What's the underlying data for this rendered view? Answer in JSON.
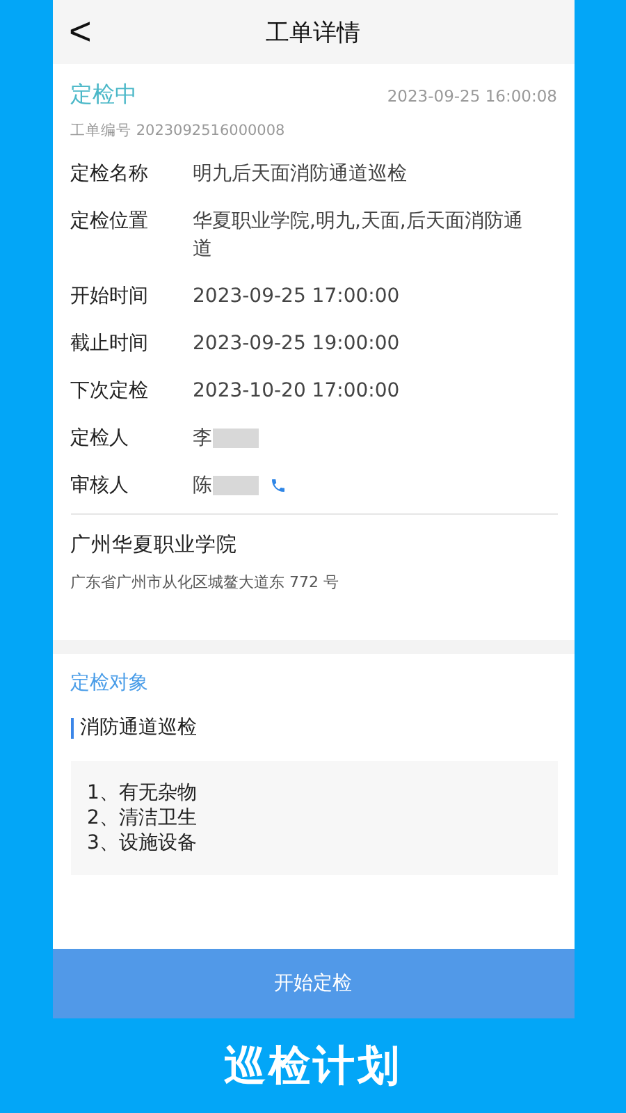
{
  "header": {
    "back": "<",
    "title": "工单详情"
  },
  "order": {
    "status": "定检中",
    "created": "2023-09-25 16:00:08",
    "number": "工单编号 2023092516000008"
  },
  "fields": [
    {
      "label": "定检名称",
      "value": "明九后天面消防通道巡检",
      "redacted": false,
      "phone": false
    },
    {
      "label": "定检位置",
      "value": "华夏职业学院,明九,天面,后天面消防通道",
      "redacted": false,
      "phone": false
    },
    {
      "label": "开始时间",
      "value": "2023-09-25 17:00:00",
      "redacted": false,
      "phone": false
    },
    {
      "label": "截止时间",
      "value": "2023-09-25 19:00:00",
      "redacted": false,
      "phone": false
    },
    {
      "label": "下次定检",
      "value": "2023-10-20 17:00:00",
      "redacted": false,
      "phone": false
    },
    {
      "label": "定检人",
      "value": "李",
      "redacted": true,
      "phone": false
    },
    {
      "label": "审核人",
      "value": "陈",
      "redacted": true,
      "phone": true
    }
  ],
  "site": {
    "name": "广州华夏职业学院",
    "address": "广东省广州市从化区城鳌大道东 772 号"
  },
  "objects": {
    "title": "定检对象",
    "item": "消防通道巡检",
    "checklist": [
      "1、有无杂物",
      "2、清洁卫生",
      "3、设施设备"
    ]
  },
  "action": "开始定检",
  "caption": "巡检计划"
}
